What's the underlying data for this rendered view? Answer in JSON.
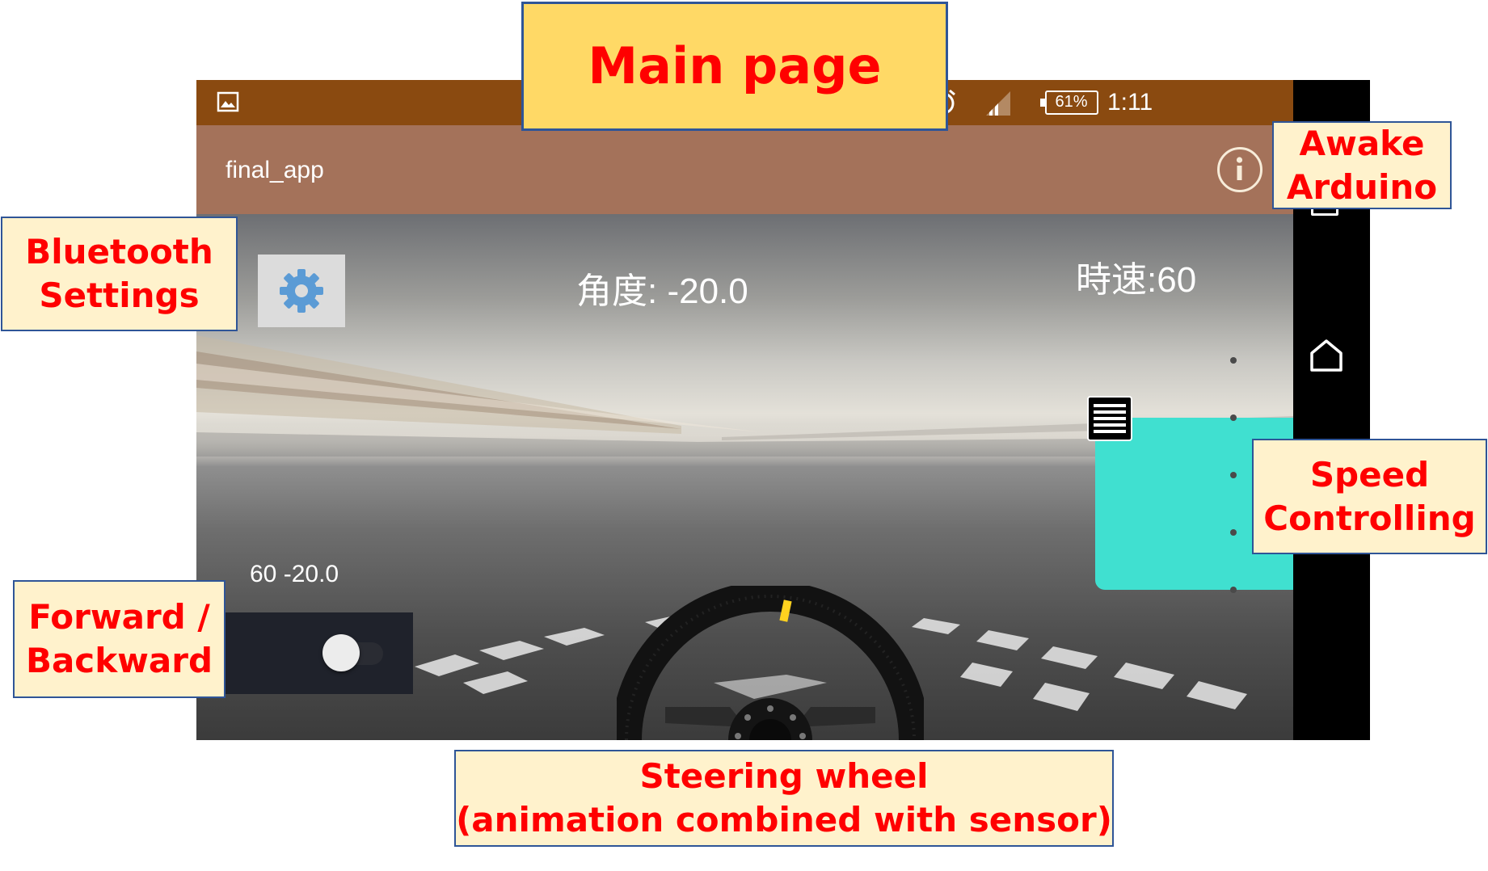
{
  "statusbar": {
    "gallery_icon": "image-icon",
    "vibrate_icon": "vibrate-icon",
    "alarm_icon": "alarm-clock-icon",
    "signal_icon": "signal-icon",
    "battery_percent": "61%",
    "clock": "1:11"
  },
  "appbar": {
    "title": "final_app",
    "info_icon": "info-icon"
  },
  "main": {
    "settings_icon": "gear-icon",
    "angle_text": "角度: -20.0",
    "speed_text": "時速:60",
    "debug_text": "60 -20.0",
    "speed_handle_icon": "menu-lines-icon",
    "forward_backward_toggle": {
      "checked": false
    },
    "speed_slider_stops": 5
  },
  "navbar": {
    "recents_icon": "square-icon",
    "home_icon": "home-icon",
    "back_icon": "back-triangle-icon"
  },
  "annotations": {
    "main_page": "Main page",
    "awake_arduino": "Awake\nArduino",
    "bluetooth_settings": "Bluetooth\nSettings",
    "speed_controlling": "Speed\nControlling",
    "forward_backward": "Forward /\nBackward",
    "steering_wheel": "Steering wheel\n(animation combined with sensor)"
  },
  "colors": {
    "status_bar": "#8a4a10",
    "app_bar": "#a4725a",
    "speed_panel": "#40e0d0",
    "settings_icon": "#5b9bd5",
    "callout_fill": "#fff2cc",
    "main_title_fill": "#ffd966",
    "callout_text": "#ff0000",
    "callout_border": "#2f5597"
  }
}
